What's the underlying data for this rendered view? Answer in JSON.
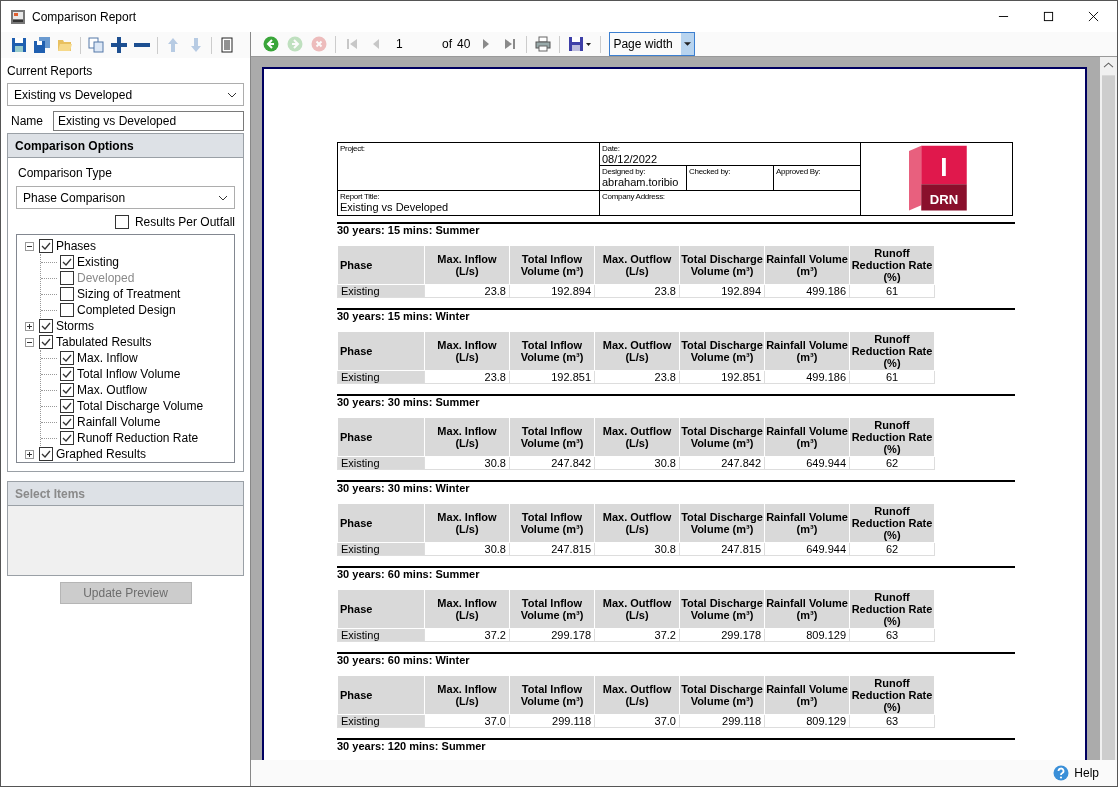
{
  "window": {
    "title": "Comparison Report"
  },
  "left_toolbar": [
    {
      "kind": "save",
      "disabled": false
    },
    {
      "kind": "save-all",
      "disabled": false
    },
    {
      "kind": "open",
      "disabled": false
    },
    {
      "kind": "sep"
    },
    {
      "kind": "copy",
      "disabled": false
    },
    {
      "kind": "add",
      "disabled": false
    },
    {
      "kind": "remove",
      "disabled": false
    },
    {
      "kind": "sep"
    },
    {
      "kind": "up",
      "disabled": true
    },
    {
      "kind": "down",
      "disabled": true
    },
    {
      "kind": "sep"
    },
    {
      "kind": "sheet",
      "disabled": false
    }
  ],
  "current_reports": {
    "label": "Current Reports",
    "value": "Existing vs Developed"
  },
  "name_field": {
    "label": "Name",
    "value": "Existing vs Developed"
  },
  "comparison_options": {
    "title": "Comparison Options",
    "type_label": "Comparison Type",
    "type_value": "Phase Comparison",
    "results_per_outfall": {
      "label": "Results Per Outfall",
      "checked": false
    },
    "tree": [
      {
        "label": "Phases",
        "checked": true,
        "expanded": true,
        "disabled": false,
        "children": [
          {
            "label": "Existing",
            "checked": true,
            "disabled": false
          },
          {
            "label": "Developed",
            "checked": false,
            "disabled": true
          },
          {
            "label": "Sizing of Treatment",
            "checked": false,
            "disabled": false
          },
          {
            "label": "Completed Design",
            "checked": false,
            "disabled": false
          }
        ]
      },
      {
        "label": "Storms",
        "checked": true,
        "expanded": false,
        "disabled": false
      },
      {
        "label": "Tabulated Results",
        "checked": true,
        "expanded": true,
        "disabled": false,
        "children": [
          {
            "label": "Max. Inflow",
            "checked": true,
            "disabled": false
          },
          {
            "label": "Total Inflow Volume",
            "checked": true,
            "disabled": false
          },
          {
            "label": "Max. Outflow",
            "checked": true,
            "disabled": false
          },
          {
            "label": "Total Discharge Volume",
            "checked": true,
            "disabled": false
          },
          {
            "label": "Rainfall Volume",
            "checked": true,
            "disabled": false
          },
          {
            "label": "Runoff Reduction Rate",
            "checked": true,
            "disabled": false
          }
        ]
      },
      {
        "label": "Graphed Results",
        "checked": true,
        "expanded": false,
        "disabled": false
      }
    ]
  },
  "select_items": {
    "title": "Select Items",
    "disabled": true
  },
  "update_button": {
    "label": "Update Preview",
    "disabled": true
  },
  "viewer_toolbar": {
    "back": {
      "disabled": false
    },
    "forward": {
      "disabled": true
    },
    "stop": {
      "disabled": true
    },
    "first": {
      "disabled": true
    },
    "prev": {
      "disabled": true
    },
    "page": "1",
    "of_label": "of",
    "total": "40",
    "next": {
      "disabled": false
    },
    "last": {
      "disabled": false
    },
    "zoom": "Page width"
  },
  "report": {
    "header": {
      "project_label": "Project:",
      "date_label": "Date:",
      "date": "08/12/2022",
      "designed_label": "Designed by:",
      "designed": "abraham.toribio",
      "checked_label": "Checked by:",
      "approved_label": "Approved By:",
      "title_label": "Report Title:",
      "title": "Existing vs Developed",
      "address_label": "Company Address:",
      "logo": {
        "letter": "I",
        "label": "DRN"
      }
    },
    "sections": [
      {
        "heading": "30 years: 15 mins: Summer",
        "columns": [
          "Phase",
          "Max. Inflow (L/s)",
          "Total Inflow Volume (m³)",
          "Max. Outflow (L/s)",
          "Total Discharge Volume (m³)",
          "Rainfall Volume (m³)",
          "Runoff Reduction Rate (%)"
        ],
        "rows": [
          [
            "Existing",
            "23.8",
            "192.894",
            "23.8",
            "192.894",
            "499.186",
            "61"
          ]
        ]
      },
      {
        "heading": "30 years: 15 mins: Winter",
        "columns": [
          "Phase",
          "Max. Inflow (L/s)",
          "Total Inflow Volume (m³)",
          "Max. Outflow (L/s)",
          "Total Discharge Volume (m³)",
          "Rainfall Volume (m³)",
          "Runoff Reduction Rate (%)"
        ],
        "rows": [
          [
            "Existing",
            "23.8",
            "192.851",
            "23.8",
            "192.851",
            "499.186",
            "61"
          ]
        ]
      },
      {
        "heading": "30 years: 30 mins: Summer",
        "columns": [
          "Phase",
          "Max. Inflow (L/s)",
          "Total Inflow Volume (m³)",
          "Max. Outflow (L/s)",
          "Total Discharge Volume (m³)",
          "Rainfall Volume (m³)",
          "Runoff Reduction Rate (%)"
        ],
        "rows": [
          [
            "Existing",
            "30.8",
            "247.842",
            "30.8",
            "247.842",
            "649.944",
            "62"
          ]
        ]
      },
      {
        "heading": "30 years: 30 mins: Winter",
        "columns": [
          "Phase",
          "Max. Inflow (L/s)",
          "Total Inflow Volume (m³)",
          "Max. Outflow (L/s)",
          "Total Discharge Volume (m³)",
          "Rainfall Volume (m³)",
          "Runoff Reduction Rate (%)"
        ],
        "rows": [
          [
            "Existing",
            "30.8",
            "247.815",
            "30.8",
            "247.815",
            "649.944",
            "62"
          ]
        ]
      },
      {
        "heading": "30 years: 60 mins: Summer",
        "columns": [
          "Phase",
          "Max. Inflow (L/s)",
          "Total Inflow Volume (m³)",
          "Max. Outflow (L/s)",
          "Total Discharge Volume (m³)",
          "Rainfall Volume (m³)",
          "Runoff Reduction Rate (%)"
        ],
        "rows": [
          [
            "Existing",
            "37.2",
            "299.178",
            "37.2",
            "299.178",
            "809.129",
            "63"
          ]
        ]
      },
      {
        "heading": "30 years: 60 mins: Winter",
        "columns": [
          "Phase",
          "Max. Inflow (L/s)",
          "Total Inflow Volume (m³)",
          "Max. Outflow (L/s)",
          "Total Discharge Volume (m³)",
          "Rainfall Volume (m³)",
          "Runoff Reduction Rate (%)"
        ],
        "rows": [
          [
            "Existing",
            "37.0",
            "299.118",
            "37.0",
            "299.118",
            "809.129",
            "63"
          ]
        ]
      },
      {
        "heading": "30 years: 120 mins: Summer"
      }
    ]
  },
  "status_bar": {
    "help": "Help"
  }
}
